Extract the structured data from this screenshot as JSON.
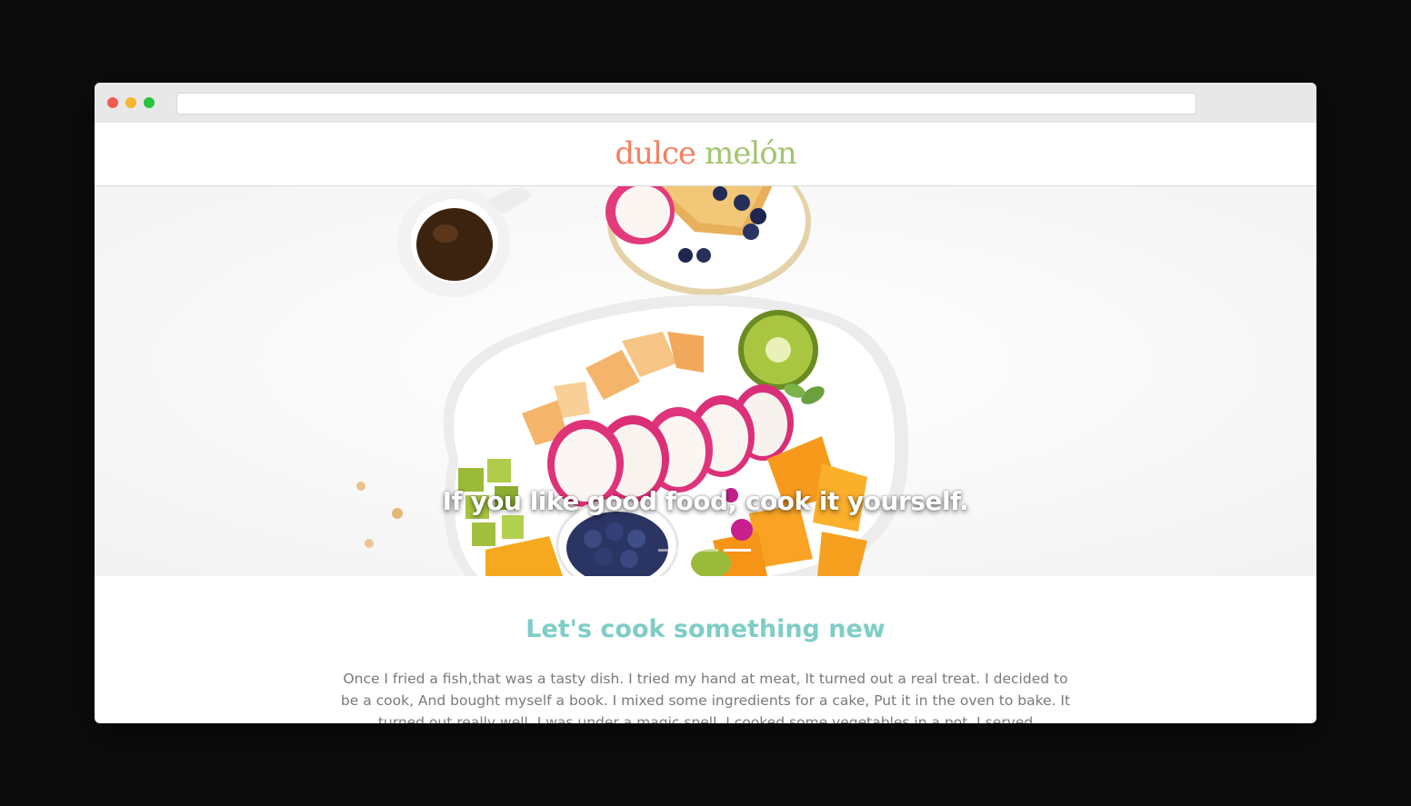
{
  "browser": {
    "url": ""
  },
  "header": {
    "logo_word1": "dulce",
    "logo_word2": "melón"
  },
  "hero": {
    "caption": "If you like good food, cook it yourself.",
    "slides": 3,
    "active_slide": 3
  },
  "intro": {
    "title": "Let's cook something new",
    "body": "Once I fried a fish,that was a tasty dish. I tried my hand at meat, It turned out a real treat. I decided to be a cook, And bought myself a book. I mixed some ingredients for a cake, Put it in the oven to bake. It turned out really well, I was under a magic spell. I cooked some vegetables in a pot, I served"
  },
  "colors": {
    "logo_primary": "#f4805f",
    "logo_secondary": "#a3c56d",
    "title_accent": "#7fcdc6",
    "body_text": "#7a7a7a"
  }
}
